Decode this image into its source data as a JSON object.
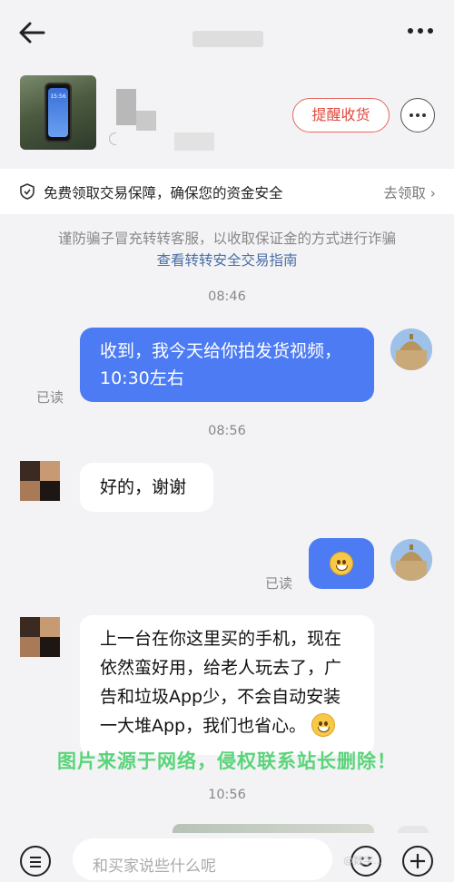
{
  "header": {
    "back_icon": "arrow-left-icon",
    "more_icon": "more-dots-icon"
  },
  "product": {
    "phone_time": "15:56",
    "remind_button": "提醒收货"
  },
  "protection": {
    "text": "免费领取交易保障，确保您的资金安全",
    "link": "去领取"
  },
  "notice": {
    "warning": "谨防骗子冒充转转客服，以收取保证金的方式进行诈骗",
    "guide_link": "查看转转安全交易指南"
  },
  "messages": [
    {
      "time": "08:46"
    },
    {
      "from": "me",
      "text": "收到，我今天给你拍发货视频，10:30左右",
      "status": "已读"
    },
    {
      "time": "08:56"
    },
    {
      "from": "other",
      "text": "好的，谢谢"
    },
    {
      "from": "me",
      "emoji": "grinning-face",
      "status": "已读"
    },
    {
      "from": "other",
      "text": "上一台在你这里买的手机，现在依然蛮好用，给老人玩去了，广告和垃圾App少，不会自动安装一大堆App，我们也省心。",
      "emoji": "smiling-face"
    },
    {
      "time": "10:56"
    }
  ],
  "watermark": "图片来源于网络，侵权联系站长删除！",
  "bottom_bar": {
    "placeholder": "和买家说些什么呢",
    "source_mark": "@数字..."
  },
  "colors": {
    "accent_blue": "#4c7bf3",
    "remind_red": "#e0493d",
    "link_blue": "#4a6fa5",
    "watermark_green": "#5ad47a"
  }
}
